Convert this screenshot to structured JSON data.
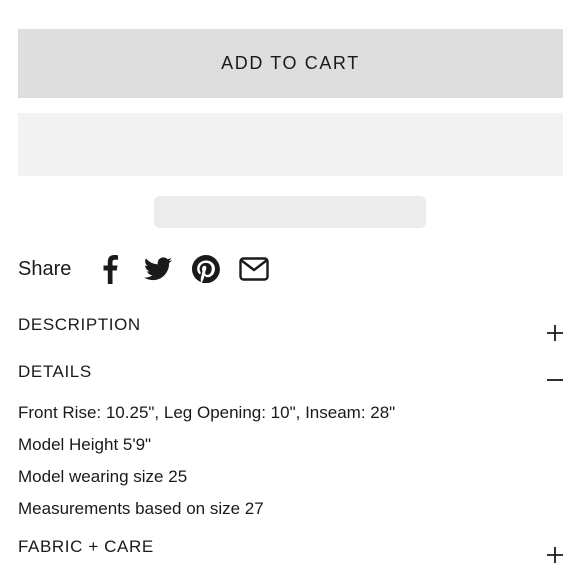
{
  "cart": {
    "add_to_cart_label": "ADD TO CART"
  },
  "share": {
    "label": "Share",
    "icons": [
      "facebook-icon",
      "twitter-icon",
      "pinterest-icon",
      "email-icon"
    ]
  },
  "accordion": {
    "description": {
      "title": "DESCRIPTION",
      "state": "collapsed",
      "toggle_icon": "plus-icon"
    },
    "details": {
      "title": "DETAILS",
      "state": "expanded",
      "toggle_icon": "minus-icon",
      "lines": [
        "Front Rise: 10.25\", Leg Opening: 10\", Inseam: 28\"",
        "Model Height 5'9\"",
        "Model wearing size 25",
        "Measurements based on size 27"
      ]
    },
    "fabric_care": {
      "title": "FABRIC + CARE",
      "state": "collapsed",
      "toggle_icon": "plus-icon"
    }
  }
}
